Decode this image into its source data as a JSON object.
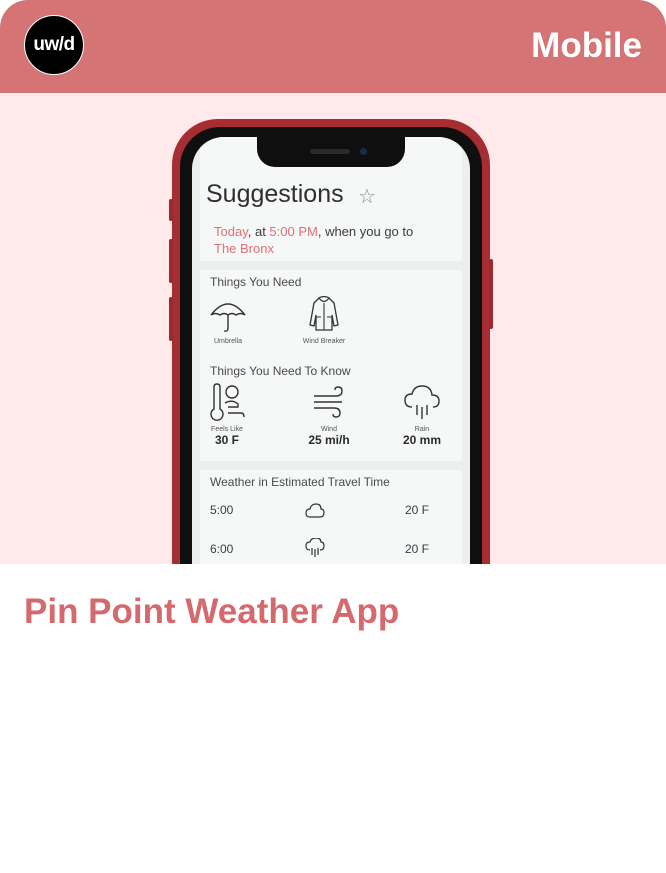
{
  "card": {
    "logo_text": "uw/d",
    "category": "Mobile",
    "title": "Pin Point Weather App"
  },
  "app": {
    "heading": "Suggestions",
    "subtitle": {
      "day": "Today",
      "at": ", at ",
      "time": "5:00  PM",
      "rest": ", when you go to",
      "place": "The Bronx"
    },
    "things_you_need": {
      "header": "Things You Need",
      "items": [
        {
          "label": "Umbrella",
          "icon": "umbrella-icon"
        },
        {
          "label": "Wind Breaker",
          "icon": "jacket-icon"
        }
      ]
    },
    "things_to_know": {
      "header": "Things You Need To Know",
      "items": [
        {
          "label": "Feels Like",
          "value": "30 F",
          "icon": "thermometer-person-icon"
        },
        {
          "label": "Wind",
          "value": "25 mi/h",
          "icon": "wind-icon"
        },
        {
          "label": "Rain",
          "value": "20 mm",
          "icon": "rain-cloud-icon"
        }
      ]
    },
    "travel_weather": {
      "header": "Weather in Estimated Travel Time",
      "rows": [
        {
          "time": "5:00",
          "icon": "cloud-icon",
          "temp": "20 F"
        },
        {
          "time": "6:00",
          "icon": "rain-cloud-icon",
          "temp": "20 F"
        }
      ]
    }
  },
  "colors": {
    "header_bg": "#d47474",
    "hero_bg": "#ffe9ea",
    "title": "#d46a6e",
    "phone_body": "#a62d31",
    "accent_pink": "#e06f76"
  }
}
